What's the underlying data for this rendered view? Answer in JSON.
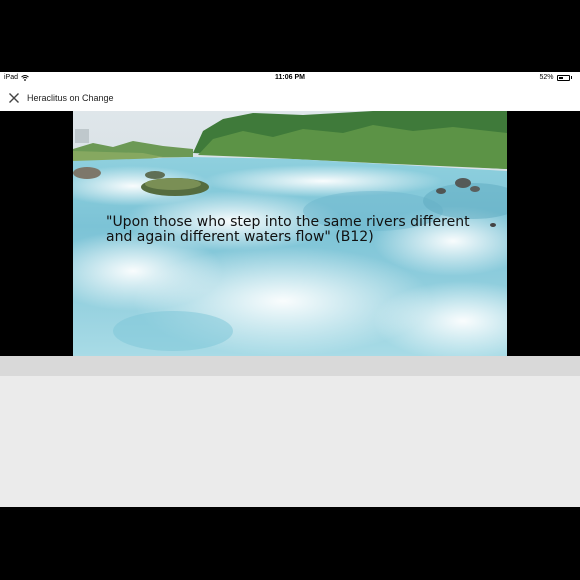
{
  "status_bar": {
    "device": "iPad",
    "time": "11:06 PM",
    "battery_percent": "52%",
    "battery_level": 0.52,
    "wifi_icon": "wifi-icon",
    "battery_icon": "battery-icon"
  },
  "nav": {
    "title": "Heraclitus on Change",
    "close_icon": "close-icon"
  },
  "slide": {
    "quote": "\"Upon those who step into the same rivers different and again different waters flow\" (B12)"
  }
}
